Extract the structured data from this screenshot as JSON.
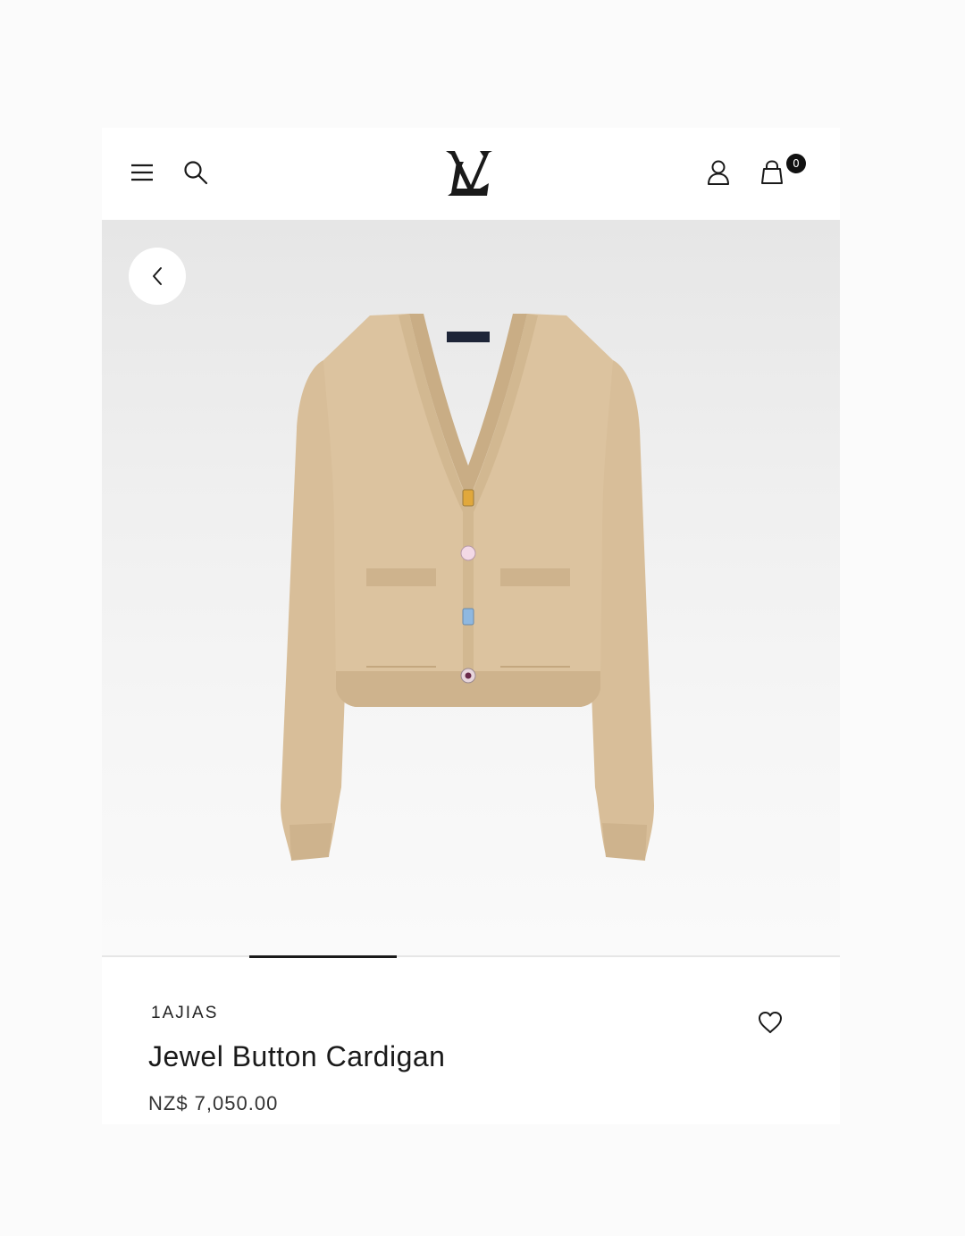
{
  "header": {
    "menu_icon": "hamburger-menu-icon",
    "search_icon": "search-icon",
    "logo_icon": "lv-monogram-logo",
    "account_icon": "user-icon",
    "cart_icon": "shopping-bag-icon",
    "cart_count": "0"
  },
  "gallery": {
    "back_icon": "chevron-left-icon",
    "image_subject": "beige knit cardigan with jewel buttons",
    "active_slide_fraction": 0.2
  },
  "product": {
    "sku": "1AJIAS",
    "name": "Jewel Button Cardigan",
    "price": "NZ$ 7,050.00",
    "wishlist_icon": "heart-icon"
  },
  "colors": {
    "knit": "#dcc39f",
    "knit_shadow": "#c9ad85",
    "text": "#1a1a1a"
  }
}
